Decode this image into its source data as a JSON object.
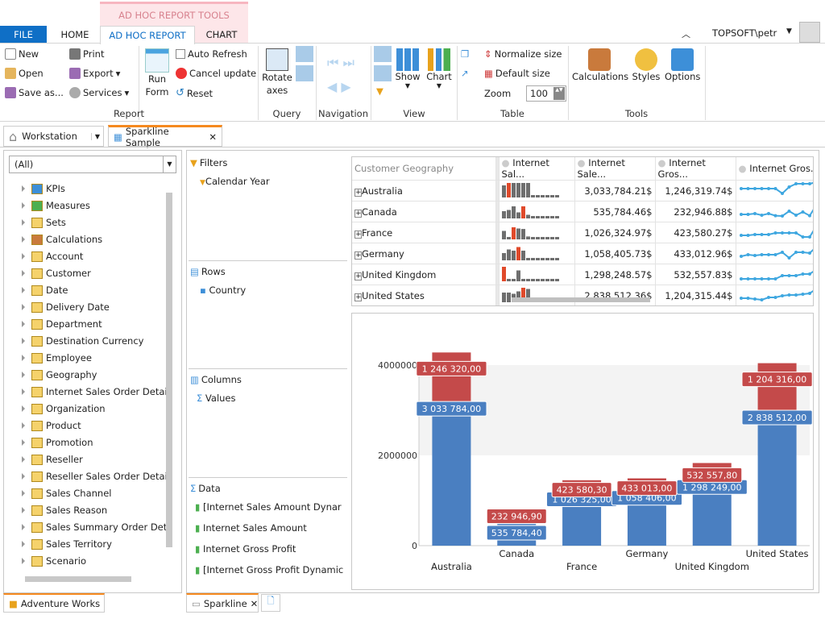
{
  "ribbon": {
    "context_tab": "AD HOC REPORT TOOLS",
    "tabs": [
      "FILE",
      "HOME",
      "AD HOC REPORT",
      "CHART"
    ],
    "active_tab": "AD HOC REPORT",
    "user": "TOPSOFT\\petr",
    "report": {
      "new": "New",
      "open": "Open",
      "save_as": "Save as...",
      "print": "Print",
      "export": "Export",
      "services": "Services",
      "run_form": "Run Form",
      "auto_refresh": "Auto Refresh",
      "cancel_update": "Cancel update",
      "reset": "Reset",
      "label": "Report"
    },
    "query": {
      "rotate_axes": "Rotate axes",
      "label": "Query"
    },
    "navigation": {
      "label": "Navigation"
    },
    "view": {
      "show": "Show",
      "chart": "Chart",
      "label": "View"
    },
    "table": {
      "normalize_size": "Normalize size",
      "default_size": "Default size",
      "zoom_label": "Zoom",
      "zoom_value": "100",
      "label": "Table"
    },
    "tools": {
      "calculations": "Calculations",
      "styles": "Styles",
      "options": "Options",
      "label": "Tools"
    }
  },
  "doc_tabs": {
    "workstation": "Workstation",
    "sparkline": "Sparkline Sample"
  },
  "sidebar": {
    "filter": "(All)",
    "items": [
      "KPIs",
      "Measures",
      "Sets",
      "Calculations",
      "Account",
      "Customer",
      "Date",
      "Delivery Date",
      "Department",
      "Destination Currency",
      "Employee",
      "Geography",
      "Internet Sales Order Detai",
      "Organization",
      "Product",
      "Promotion",
      "Reseller",
      "Reseller Sales Order Detai",
      "Sales Channel",
      "Sales Reason",
      "Sales Summary Order Det",
      "Sales Territory",
      "Scenario"
    ],
    "footer_tab": "Adventure Works"
  },
  "pivot": {
    "filters": {
      "title": "Filters",
      "items": [
        "Calendar Year"
      ]
    },
    "rows": {
      "title": "Rows",
      "items": [
        "Country"
      ]
    },
    "columns": {
      "title": "Columns",
      "items": [
        "Values"
      ]
    },
    "data": {
      "title": "Data",
      "items": [
        "[Internet Sales Amount Dynar",
        "Internet Sales Amount",
        "Internet Gross Profit",
        "[Internet Gross Profit Dynamic"
      ]
    }
  },
  "grid": {
    "headers": [
      "Customer Geography",
      "Internet Sal...",
      "Internet Sale...",
      "Internet Gros...",
      "Internet Gros..."
    ],
    "rows": [
      {
        "name": "Australia",
        "sales": "3,033,784.21$",
        "profit": "1,246,319.74$",
        "bars": [
          5,
          6,
          6,
          6,
          6,
          6,
          1,
          1,
          1,
          1,
          1,
          1
        ],
        "hi": 1,
        "line": [
          5,
          5,
          5,
          5,
          5,
          5,
          2,
          6,
          8,
          8,
          8,
          9
        ]
      },
      {
        "name": "Canada",
        "sales": "535,784.46$",
        "profit": "232,946.88$",
        "bars": [
          3,
          3.5,
          5,
          2.5,
          5,
          1.5,
          1,
          1,
          1,
          1,
          1,
          1
        ],
        "hi": 4,
        "line": [
          2,
          2,
          2.5,
          1.5,
          2.5,
          1.2,
          1,
          4,
          1.5,
          3.5,
          1.2,
          8
        ]
      },
      {
        "name": "France",
        "sales": "1,026,324.97$",
        "profit": "423,580.27$",
        "bars": [
          3.5,
          1,
          5,
          4.5,
          4.3,
          1.2,
          1,
          1,
          1,
          1,
          1,
          1
        ],
        "hi": 2,
        "line": [
          2,
          2,
          2.5,
          2.5,
          2.5,
          3.5,
          3.5,
          3.5,
          3.5,
          1,
          1,
          8
        ]
      },
      {
        "name": "Germany",
        "sales": "1,058,405.73$",
        "profit": "433,012.96$",
        "bars": [
          3,
          4.5,
          4,
          5.5,
          4,
          1,
          1,
          1,
          1,
          1,
          1,
          1
        ],
        "hi": 3,
        "line": [
          2,
          3,
          2.5,
          3,
          3,
          3,
          4.5,
          1,
          4.5,
          4.5,
          4,
          8
        ]
      },
      {
        "name": "United Kingdom",
        "sales": "1,298,248.57$",
        "profit": "532,557.83$",
        "bars": [
          6,
          1,
          1,
          4.5,
          1,
          1,
          1,
          1,
          1,
          1,
          1,
          1
        ],
        "hi": 0,
        "line": [
          1,
          1,
          1,
          1,
          1,
          1,
          3,
          3,
          3,
          4,
          4,
          7
        ]
      },
      {
        "name": "United States",
        "sales": "2,838,512.36$",
        "profit": "1,204,315.44$",
        "bars": [
          4,
          4,
          3.5,
          4.5,
          6,
          5.5,
          1,
          1,
          1,
          1,
          1,
          1
        ],
        "hi": 4,
        "line": [
          2,
          2,
          1.5,
          1,
          2.5,
          2.5,
          3.5,
          4,
          4,
          4.5,
          5,
          8
        ]
      }
    ]
  },
  "colors": {
    "accent": "#0f6fc6",
    "bar_gray": "#6e6e6e",
    "bar_highlight": "#e04a2b",
    "sparkline": "#3fa7e0",
    "chart_blue": "#4a7fc1",
    "chart_red": "#c44a4a"
  },
  "chart_data": {
    "type": "bar",
    "stacked": true,
    "categories": [
      "Australia",
      "Canada",
      "France",
      "Germany",
      "United Kingdom",
      "United States"
    ],
    "series": [
      {
        "values": [
          3033784,
          535784,
          1026325,
          1058406,
          1298249,
          2838512
        ],
        "labels": [
          "3 033 784,00",
          "535 784,40",
          "1 026 325,00",
          "1 058 406,00",
          "1 298 249,00",
          "2 838 512,00"
        ]
      },
      {
        "values": [
          1246320,
          232947,
          423580,
          433013,
          532558,
          1204316
        ],
        "labels": [
          "1 246 320,00",
          "232 946,90",
          "423 580,30",
          "433 013,00",
          "532 557,80",
          "1 204 316,00"
        ]
      }
    ],
    "yticks": [
      "0",
      "2000000",
      "4000000"
    ],
    "ylim": [
      0,
      4400000
    ]
  },
  "bottom_tabs": {
    "sparkline": "Sparkline"
  }
}
